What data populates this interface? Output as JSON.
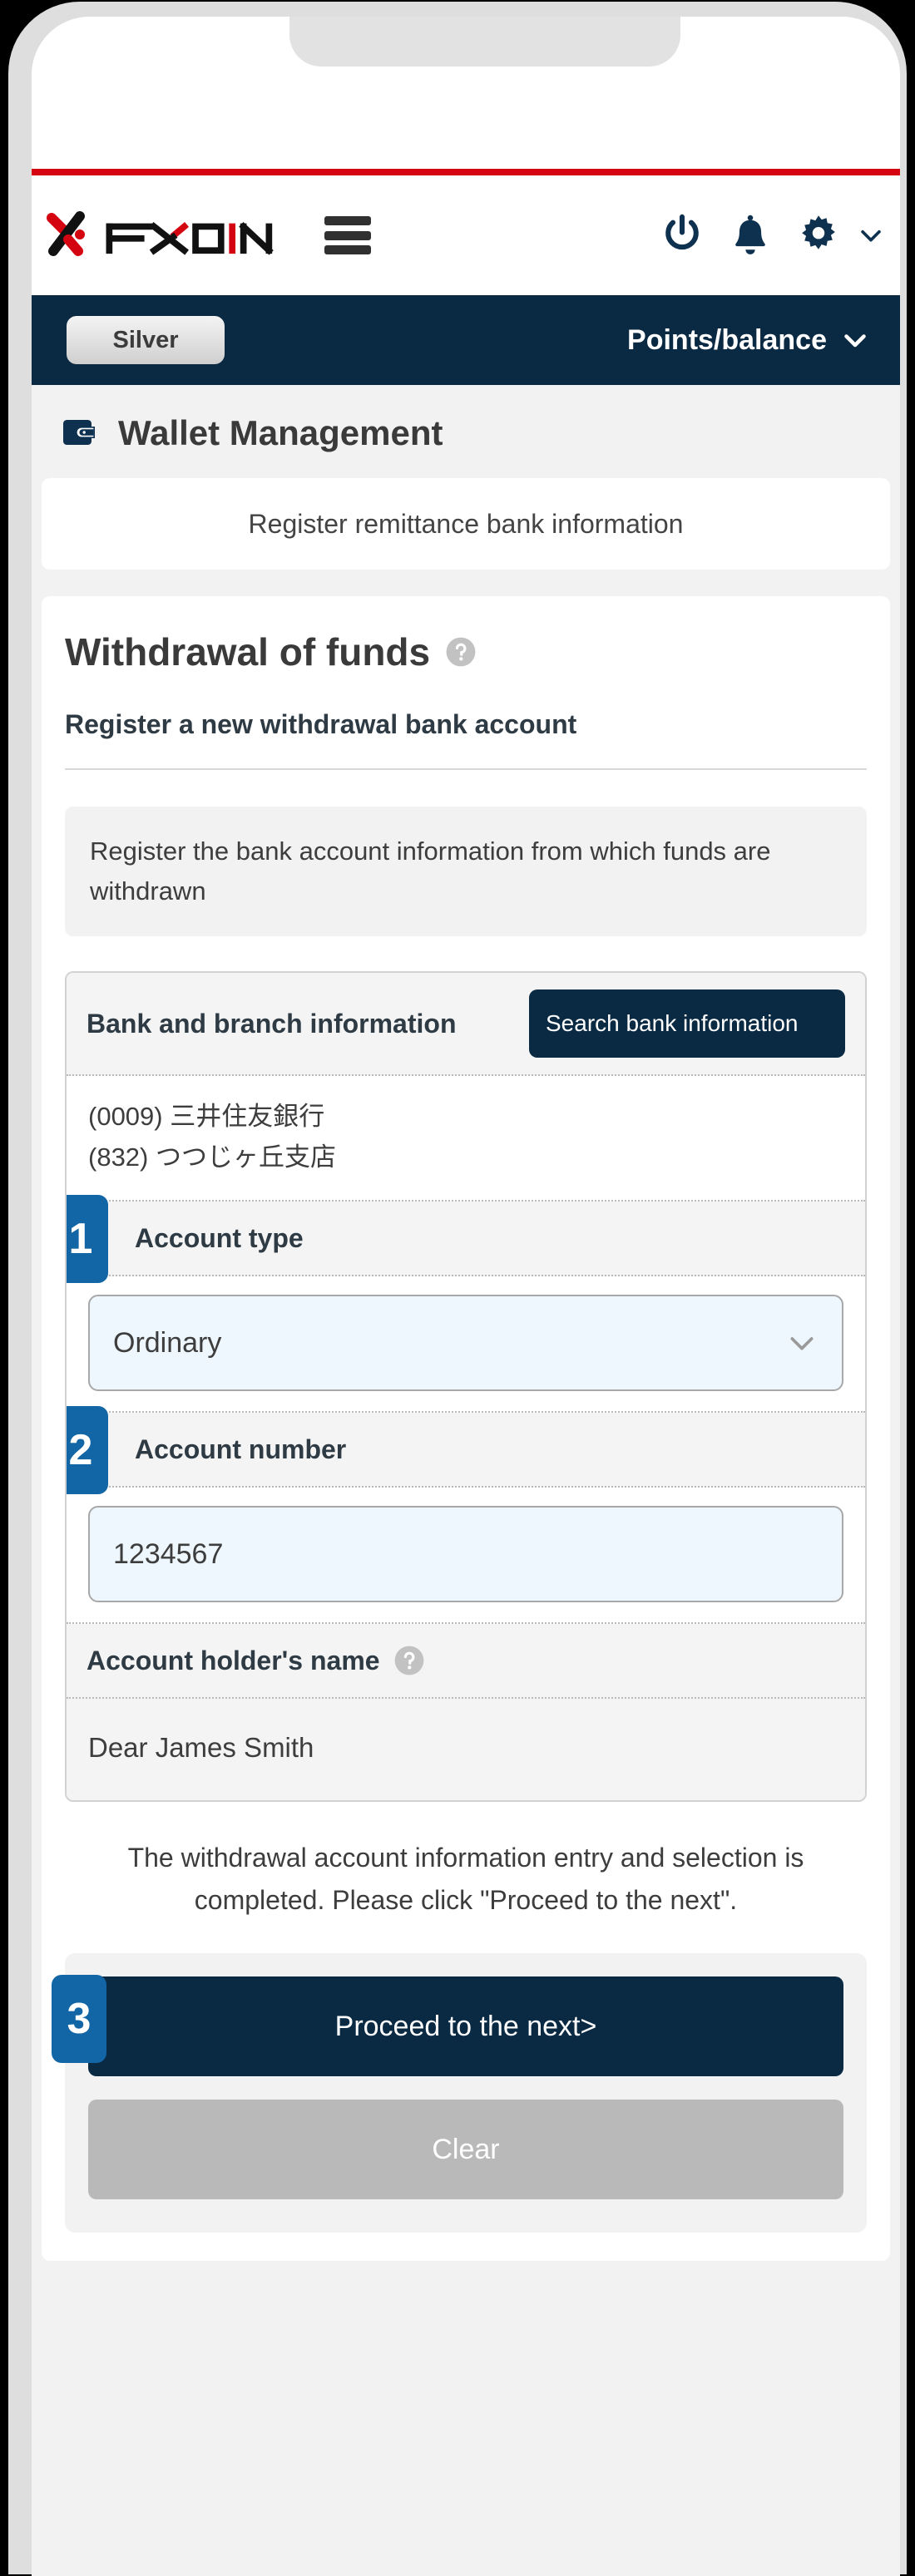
{
  "brand": {
    "logo_text": "FXON",
    "accent_red": "#d40511",
    "navy": "#0a2942",
    "step_blue": "#1366a6"
  },
  "header": {
    "menu_icon": "hamburger-icon",
    "power_icon": "power-icon",
    "bell_icon": "bell-icon",
    "gear_icon": "gear-icon",
    "caret_icon": "chevron-down-icon"
  },
  "sub_bar": {
    "rank_label": "Silver",
    "points_label": "Points/balance",
    "points_caret": "chevron-down-icon"
  },
  "page": {
    "wallet_icon": "wallet-icon",
    "title": "Wallet Management",
    "register_card_text": "Register remittance bank information"
  },
  "withdrawal": {
    "section_title": "Withdrawal of funds",
    "section_help_icon": "help-circle-icon",
    "section_subtitle": "Register a new withdrawal bank account",
    "info_text": "Register the bank account information from which funds are withdrawn"
  },
  "form": {
    "bank_info": {
      "label": "Bank and branch information",
      "search_button": "Search bank information",
      "bank_name": "(0009) 三井住友銀行",
      "branch_name": "(832) つつじヶ丘支店"
    },
    "account_type": {
      "step": "1",
      "label": "Account type",
      "value": "Ordinary",
      "caret_icon": "chevron-down-icon"
    },
    "account_number": {
      "step": "2",
      "label": "Account number",
      "value": "1234567"
    },
    "account_holder": {
      "label": "Account holder's name",
      "help_icon": "help-circle-icon",
      "value": "Dear James Smith"
    }
  },
  "footer": {
    "completion_note": "The withdrawal account information entry and selection is completed. Please click \"Proceed to the next\".",
    "proceed_step": "3",
    "proceed_label": "Proceed to the next>",
    "clear_label": "Clear"
  }
}
